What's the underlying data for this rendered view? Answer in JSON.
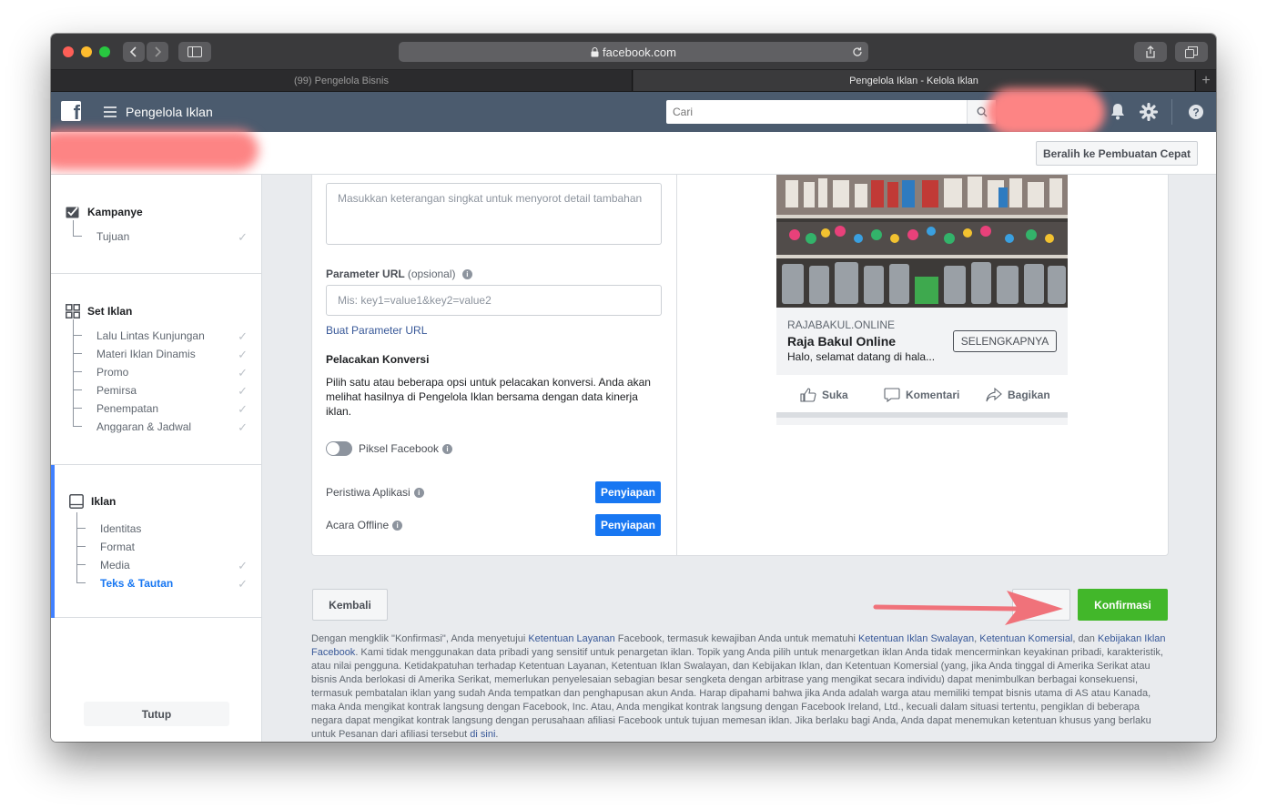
{
  "browser": {
    "url": "facebook.com",
    "tabs": [
      "(99) Pengelola Bisnis",
      "Pengelola Iklan - Kelola Iklan"
    ],
    "new_tab": "+"
  },
  "app": {
    "title": "Pengelola Iklan",
    "search_placeholder": "Cari",
    "quick_create": "Beralih ke Pembuatan Cepat"
  },
  "sidebar": {
    "campaign": {
      "title": "Kampanye",
      "items": [
        "Tujuan"
      ]
    },
    "adset": {
      "title": "Set Iklan",
      "items": [
        "Lalu Lintas Kunjungan",
        "Materi Iklan Dinamis",
        "Promo",
        "Pemirsa",
        "Penempatan",
        "Anggaran & Jadwal"
      ]
    },
    "ad": {
      "title": "Iklan",
      "items": [
        "Identitas",
        "Format",
        "Media",
        "Teks & Tautan"
      ]
    },
    "close": "Tutup"
  },
  "form": {
    "description_placeholder": "Masukkan keterangan singkat untuk menyorot detail tambahan",
    "url_params_label": "Parameter URL",
    "url_params_optional": "(opsional)",
    "url_params_placeholder": "Mis: key1=value1&key2=value2",
    "build_params_link": "Buat Parameter URL",
    "conversion_title": "Pelacakan Konversi",
    "conversion_desc": "Pilih satu atau beberapa opsi untuk pelacakan konversi. Anda akan melihat hasilnya di Pengelola Iklan bersama dengan data kinerja iklan.",
    "pixel_label": "Piksel Facebook",
    "app_events_label": "Peristiwa Aplikasi",
    "offline_events_label": "Acara Offline",
    "setup_label": "Penyiapan"
  },
  "preview": {
    "domain": "RAJABAKUL.ONLINE",
    "headline": "Raja Bakul Online",
    "description": "Halo, selamat datang di hala...",
    "cta": "SELENGKAPNYA",
    "like": "Suka",
    "comment": "Komentari",
    "share": "Bagikan"
  },
  "footer": {
    "back": "Kembali",
    "confirm": "Konfirmasi",
    "legal": {
      "t1": "Dengan mengklik \"Konfirmasi\", Anda menyetujui ",
      "l1": "Ketentuan Layanan",
      "t2": " Facebook, termasuk kewajiban Anda untuk mematuhi ",
      "l2": "Ketentuan Iklan Swalayan",
      "t3": ", ",
      "l3": "Ketentuan Komersial",
      "t4": ", dan ",
      "l4": "Kebijakan Iklan Facebook",
      "t5": ". Kami tidak menggunakan data pribadi yang sensitif untuk penargetan iklan. Topik yang Anda pilih untuk menargetkan iklan Anda tidak mencerminkan keyakinan pribadi, karakteristik, atau nilai pengguna. Ketidakpatuhan terhadap Ketentuan Layanan, Ketentuan Iklan Swalayan, dan Kebijakan Iklan, dan Ketentuan Komersial (yang, jika Anda tinggal di Amerika Serikat atau bisnis Anda berlokasi di Amerika Serikat, memerlukan penyelesaian sebagian besar sengketa dengan arbitrase yang mengikat secara individu) dapat menimbulkan berbagai konsekuensi, termasuk pembatalan iklan yang sudah Anda tempatkan dan penghapusan akun Anda. Harap dipahami bahwa jika Anda adalah warga atau memiliki tempat bisnis utama di AS atau Kanada, maka Anda mengikat kontrak langsung dengan Facebook, Inc. Atau, Anda mengikat kontrak langsung dengan Facebook Ireland, Ltd., kecuali dalam situasi tertentu, pengiklan di beberapa negara dapat mengikat kontrak langsung dengan perusahaan afiliasi Facebook untuk tujuan memesan iklan. Jika berlaku bagi Anda, Anda dapat menemukan ketentuan khusus yang berlaku untuk Pesanan dari afiliasi tersebut ",
      "l5": "di sini",
      "t6": "."
    }
  },
  "colors": {
    "confirm": "#42b72a",
    "link": "#385898",
    "primary": "#1877f2",
    "fb_bar": "#4b5b6e",
    "arrow": "#f0727a"
  }
}
